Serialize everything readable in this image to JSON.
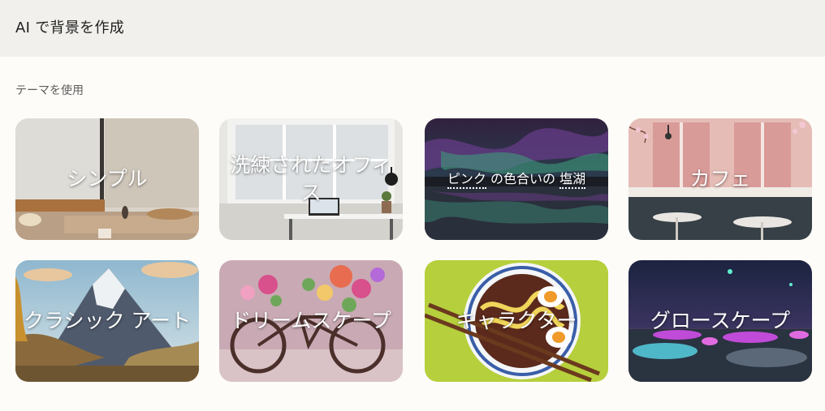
{
  "header": {
    "title": "AI で背景を作成"
  },
  "section": {
    "label": "テーマを使用"
  },
  "themes": [
    {
      "label": "シンプル",
      "icon": "room-scene"
    },
    {
      "label": "洗練されたオフィス",
      "icon": "office-scene"
    },
    {
      "label_parts": [
        "ピンク",
        "の色合いの",
        "塩湖"
      ],
      "icon": "aurora-lake-scene"
    },
    {
      "label": "カフェ",
      "icon": "cafe-scene"
    },
    {
      "label": "クラシック アート",
      "icon": "mountain-painting"
    },
    {
      "label": "ドリームスケープ",
      "icon": "flower-bicycle"
    },
    {
      "label": "キャラクター",
      "icon": "ramen-bowl"
    },
    {
      "label": "グロースケープ",
      "icon": "glowing-landscape"
    }
  ],
  "colors": {
    "header_bg": "#f1f0ec",
    "page_bg": "#fdfcf8",
    "label_text": "#ffffff"
  }
}
